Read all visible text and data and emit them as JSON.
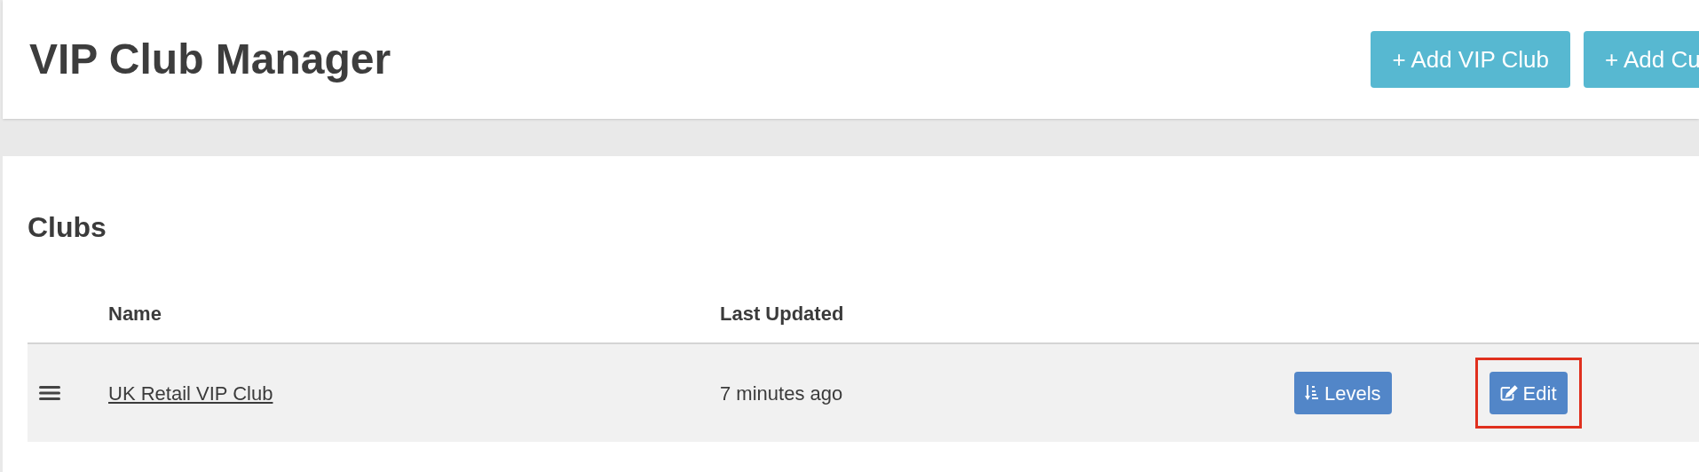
{
  "header": {
    "title": "VIP Club Manager",
    "buttons": [
      "+ Add VIP Club",
      "+ Add Cu"
    ]
  },
  "clubs": {
    "title": "Clubs",
    "columns": [
      "Name",
      "Last Updated"
    ],
    "rows": [
      {
        "name": "UK Retail VIP Club",
        "updated": "7 minutes ago",
        "actions": [
          {
            "kind": "levels",
            "label": "Levels",
            "highlighted": false
          },
          {
            "kind": "edit",
            "label": "Edit",
            "highlighted": true
          }
        ]
      }
    ]
  }
}
